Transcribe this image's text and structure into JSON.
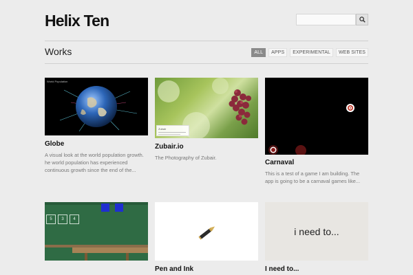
{
  "header": {
    "title": "Helix Ten",
    "search": {
      "value": "",
      "placeholder": ""
    }
  },
  "section": {
    "title": "Works"
  },
  "filters": [
    "All",
    "Apps",
    "Experimental",
    "Web Sites"
  ],
  "works": [
    {
      "title": "Globe",
      "desc": "A visual look at the world population growth. he world population has experienced continuous growth since the end of the...",
      "overlay": "World Population"
    },
    {
      "title": "Zubair.io",
      "desc": "The Photography of Zubair.",
      "overlay": "Zubair"
    },
    {
      "title": "Carnaval",
      "desc": "This is a test of a game I am building. The app is going to be a carnaval games like..."
    },
    {
      "title": "",
      "desc": "",
      "numbers": [
        "5",
        "3",
        "4"
      ]
    },
    {
      "title": "Pen and Ink",
      "desc": ""
    },
    {
      "title": "I need to...",
      "desc": "",
      "thumb_text": "i need to..."
    }
  ],
  "colors": {
    "active_filter": "#8a8a8a",
    "rule": "#cfcfcf",
    "background": "#ececec"
  }
}
